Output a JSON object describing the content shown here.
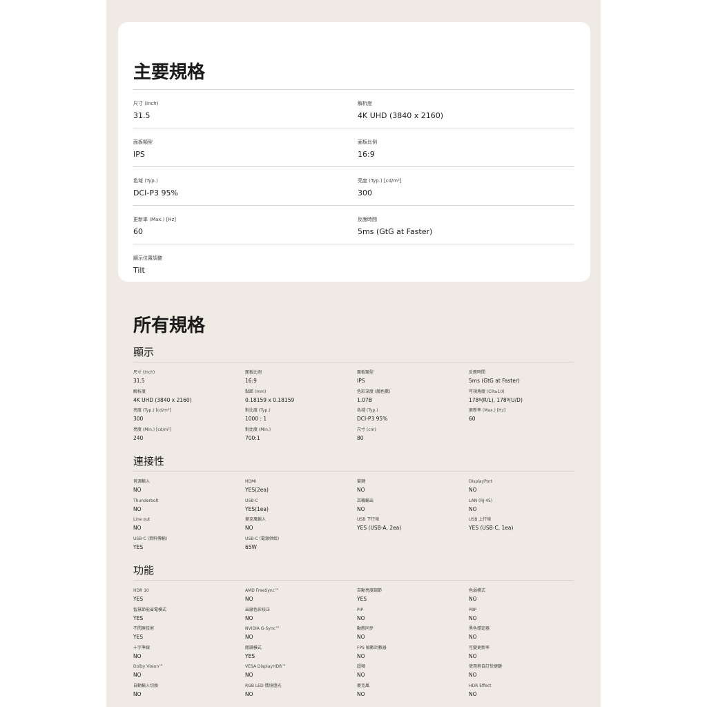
{
  "main_specs": {
    "title": "主要規格",
    "items": [
      {
        "label": "尺寸 (Inch)",
        "value": "31.5"
      },
      {
        "label": "解析度",
        "value": "4K UHD (3840 x 2160)"
      },
      {
        "label": "面板類型",
        "value": "IPS"
      },
      {
        "label": "面板比例",
        "value": "16:9"
      },
      {
        "label": "色域 (Typ.)",
        "value": "DCI-P3 95%"
      },
      {
        "label": "亮度 (Typ.) [cd/m²]",
        "value": "300"
      },
      {
        "label": "更新率 (Max.) [Hz]",
        "value": "60"
      },
      {
        "label": "反應時間",
        "value": "5ms (GtG at Faster)"
      },
      {
        "label": "顯示位置調整",
        "value": "Tilt"
      }
    ]
  },
  "all_specs": {
    "title": "所有規格",
    "sections": [
      {
        "name": "顯示",
        "items": [
          {
            "label": "尺寸 (Inch)",
            "value": "31.5"
          },
          {
            "label": "面板比例",
            "value": "16:9"
          },
          {
            "label": "面板類型",
            "value": "IPS"
          },
          {
            "label": "反應時間",
            "value": "5ms (GtG at Faster)"
          },
          {
            "label": "解析度",
            "value": "4K UHD (3840 x 2160)"
          },
          {
            "label": "點距 (mm)",
            "value": "0.18159 x 0.18159"
          },
          {
            "label": "色彩深度 (顏色數)",
            "value": "1.07B"
          },
          {
            "label": "可視角度 (CR≥10)",
            "value": "178º(R/L), 178º(U/D)"
          },
          {
            "label": "亮度 (Typ.) [cd/m²]",
            "value": "300"
          },
          {
            "label": "對比度 (Typ.)",
            "value": "1000 : 1"
          },
          {
            "label": "色域 (Typ.)",
            "value": "DCI-P3 95%"
          },
          {
            "label": "更新率 (Max.) [Hz]",
            "value": "60"
          },
          {
            "label": "亮度 (Min.) [cd/m²]",
            "value": "240"
          },
          {
            "label": "對比度 (Min.)",
            "value": "700:1"
          },
          {
            "label": "尺寸 (cm)",
            "value": "80"
          }
        ]
      },
      {
        "name": "連接性",
        "items": [
          {
            "label": "音源輸入",
            "value": "NO"
          },
          {
            "label": "HDMI",
            "value": "YES(2ea)"
          },
          {
            "label": "菊鏈",
            "value": "NO"
          },
          {
            "label": "DisplayPort",
            "value": "NO"
          },
          {
            "label": "Thunderbolt",
            "value": "NO"
          },
          {
            "label": "USB-C",
            "value": "YES(1ea)"
          },
          {
            "label": "耳機輸出",
            "value": "NO"
          },
          {
            "label": "LAN (RJ-45)",
            "value": "NO"
          },
          {
            "label": "Line out",
            "value": "NO"
          },
          {
            "label": "麥克風輸入",
            "value": "NO"
          },
          {
            "label": "USB 下行埠",
            "value": "YES (USB-A, 2ea)"
          },
          {
            "label": "USB 上行埠",
            "value": "YES (USB-C, 1ea)"
          },
          {
            "label": "USB-C (資料傳輸)",
            "value": "YES"
          },
          {
            "label": "USB-C (電源供給)",
            "value": "65W"
          }
        ]
      },
      {
        "name": "功能",
        "items": [
          {
            "label": "HDR 10",
            "value": "YES"
          },
          {
            "label": "AMD FreeSync™",
            "value": "NO"
          },
          {
            "label": "自動亮度調節",
            "value": "YES"
          },
          {
            "label": "色弱模式",
            "value": "NO"
          },
          {
            "label": "智慧節能省電模式",
            "value": "YES"
          },
          {
            "label": "出廠色彩校正",
            "value": "NO"
          },
          {
            "label": "PIP",
            "value": "NO"
          },
          {
            "label": "PBP",
            "value": "NO"
          },
          {
            "label": "不閃屏技術",
            "value": "YES"
          },
          {
            "label": "NVIDIA G-Sync™",
            "value": "NO"
          },
          {
            "label": "動態同步",
            "value": "NO"
          },
          {
            "label": "黑色穩定器",
            "value": "NO"
          },
          {
            "label": "十字準線",
            "value": "NO"
          },
          {
            "label": "閱讀模式",
            "value": "YES"
          },
          {
            "label": "FPS 幀數計數器",
            "value": "NO"
          },
          {
            "label": "可變更新率",
            "value": "NO"
          },
          {
            "label": "Dolby Vision™",
            "value": "NO"
          },
          {
            "label": "VESA DisplayHDR™",
            "value": "NO"
          },
          {
            "label": "超頻",
            "value": "NO"
          },
          {
            "label": "使用者自訂快捷鍵",
            "value": "NO"
          },
          {
            "label": "自動輸入切換",
            "value": "NO"
          },
          {
            "label": "RGB LED 情境燈光",
            "value": "NO"
          },
          {
            "label": "麥克風",
            "value": "NO"
          },
          {
            "label": "HDR Effect",
            "value": "NO"
          }
        ]
      }
    ]
  }
}
